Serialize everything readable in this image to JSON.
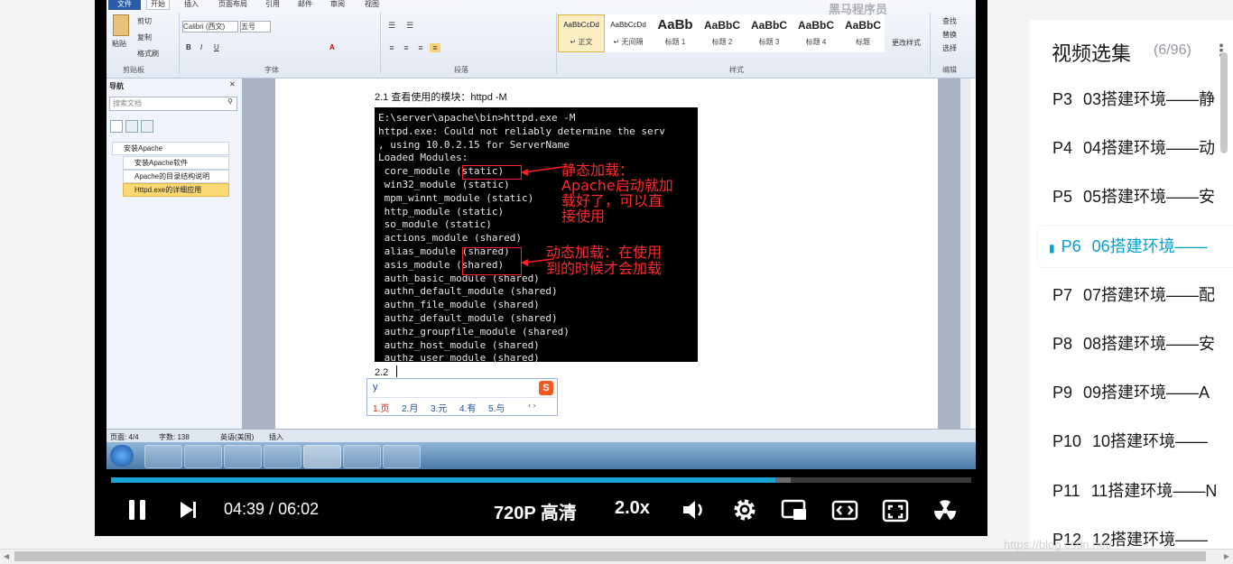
{
  "ribbon": {
    "tabs": [
      "文件",
      "开始",
      "插入",
      "页面布局",
      "引用",
      "邮件",
      "审阅",
      "视图"
    ],
    "clipboard": {
      "paste": "粘贴",
      "cut": "剪切",
      "copy": "复制",
      "format_painter": "格式刷",
      "group": "剪贴板"
    },
    "font": {
      "name": "Calibri (西文)",
      "size": "五号",
      "group": "字体"
    },
    "paragraph_group": "段落",
    "styles": [
      {
        "sample": "AaBbCcDd",
        "name": "↵ 正文"
      },
      {
        "sample": "AaBbCcDd",
        "name": "↵ 无间隔"
      },
      {
        "sample": "AaBb",
        "name": "标题 1"
      },
      {
        "sample": "AaBbC",
        "name": "标题 2"
      },
      {
        "sample": "AaBbC",
        "name": "标题 3"
      },
      {
        "sample": "AaBbC",
        "name": "标题 4"
      },
      {
        "sample": "AaBbC",
        "name": "标题"
      }
    ],
    "styles_group": "样式",
    "change_styles": "更改样式",
    "editing": {
      "find": "查找",
      "replace": "替换",
      "select": "选择",
      "group": "编辑"
    }
  },
  "nav": {
    "title": "导航",
    "search_placeholder": "搜索文档",
    "items": [
      "安装Apache",
      "安装Apache软件",
      "Apache的目录结构说明",
      "Httpd.exe的详细应用"
    ]
  },
  "doc": {
    "heading_21": "2.1 查看使用的模块：httpd  -M",
    "console_lines": [
      "E:\\server\\apache\\bin>httpd.exe -M",
      "httpd.exe: Could not reliably determine the serv",
      ", using 10.0.2.15 for ServerName",
      "Loaded Modules:",
      " core_module (static)",
      " win32_module (static)",
      " mpm_winnt_module (static)",
      " http_module (static)",
      " so_module (static)",
      " actions_module (shared)",
      " alias_module (shared)",
      " asis_module (shared)",
      " auth_basic_module (shared)",
      " authn_default_module (shared)",
      " authn_file_module (shared)",
      " authz_default_module (shared)",
      " authz_groupfile_module (shared)",
      " authz_host_module (shared)",
      " authz_user_module (shared)"
    ],
    "annotation_static": [
      "静态加载：",
      "Apache启动就加",
      "载好了，可以直",
      "接使用"
    ],
    "annotation_shared": [
      "动态加载：在使用",
      "到的时候才会加载"
    ],
    "heading_22": "2.2"
  },
  "ime": {
    "input": "y",
    "candidates": [
      "1.页",
      "2.月",
      "3.元",
      "4.有",
      "5.与"
    ]
  },
  "statusbar": {
    "page": "页面: 4/4",
    "words": "字数: 138",
    "lang": "英语(美国)",
    "mode": "插入"
  },
  "watermark": "黑马程序员",
  "player": {
    "current_time": "04:39",
    "divider": "/",
    "total_time": "06:02",
    "progress": 0.772,
    "buffered": 0.79,
    "quality": "720P 高清",
    "speed": "2.0x"
  },
  "sidebar": {
    "title": "视频选集",
    "count": "(6/96)",
    "episodes": [
      {
        "p": "P3",
        "title": "03搭建环境——静"
      },
      {
        "p": "P4",
        "title": "04搭建环境——动"
      },
      {
        "p": "P5",
        "title": "05搭建环境——安"
      },
      {
        "p": "P6",
        "title": "06搭建环境——",
        "active": true
      },
      {
        "p": "P7",
        "title": "07搭建环境——配"
      },
      {
        "p": "P8",
        "title": "08搭建环境——安"
      },
      {
        "p": "P9",
        "title": "09搭建环境——A"
      },
      {
        "p": "P10",
        "title": "10搭建环境——"
      },
      {
        "p": "P11",
        "title": "11搭建环境——N"
      },
      {
        "p": "P12",
        "title": "12搭建环境——"
      }
    ]
  },
  "url_watermark": "https://blog.csdn.net/",
  "colors": {
    "accent": "#00a1d6",
    "progress": "#1aa3d6"
  }
}
